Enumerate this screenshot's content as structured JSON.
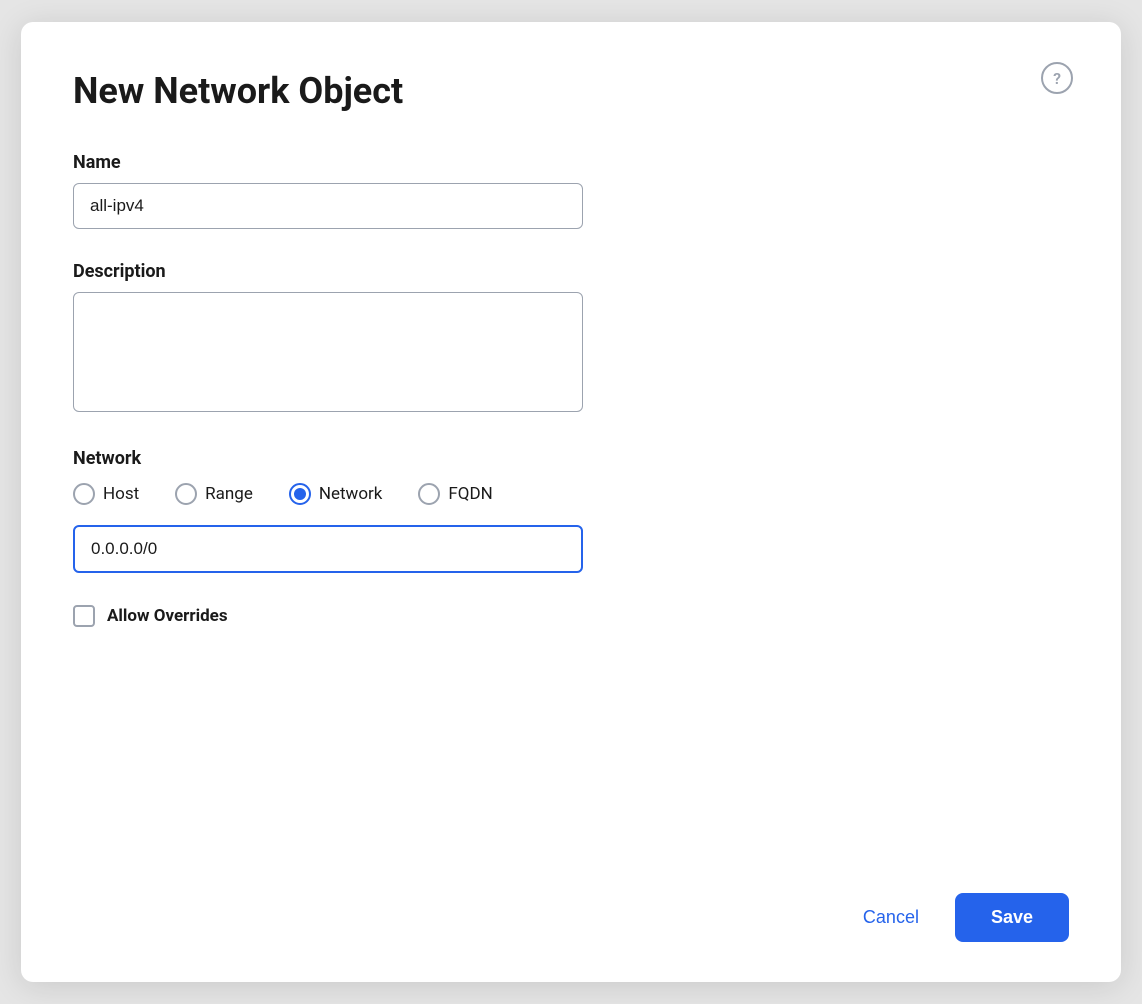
{
  "dialog": {
    "title": "New Network Object",
    "help_icon_label": "?"
  },
  "form": {
    "name_label": "Name",
    "name_value": "all-ipv4",
    "name_placeholder": "",
    "description_label": "Description",
    "description_value": "",
    "description_placeholder": "",
    "network_section_label": "Network",
    "radio_options": [
      {
        "id": "host",
        "label": "Host",
        "selected": false
      },
      {
        "id": "range",
        "label": "Range",
        "selected": false
      },
      {
        "id": "network",
        "label": "Network",
        "selected": true
      },
      {
        "id": "fqdn",
        "label": "FQDN",
        "selected": false
      }
    ],
    "network_value": "0.0.0.0/0",
    "allow_overrides_label": "Allow Overrides",
    "allow_overrides_checked": false
  },
  "footer": {
    "cancel_label": "Cancel",
    "save_label": "Save"
  }
}
